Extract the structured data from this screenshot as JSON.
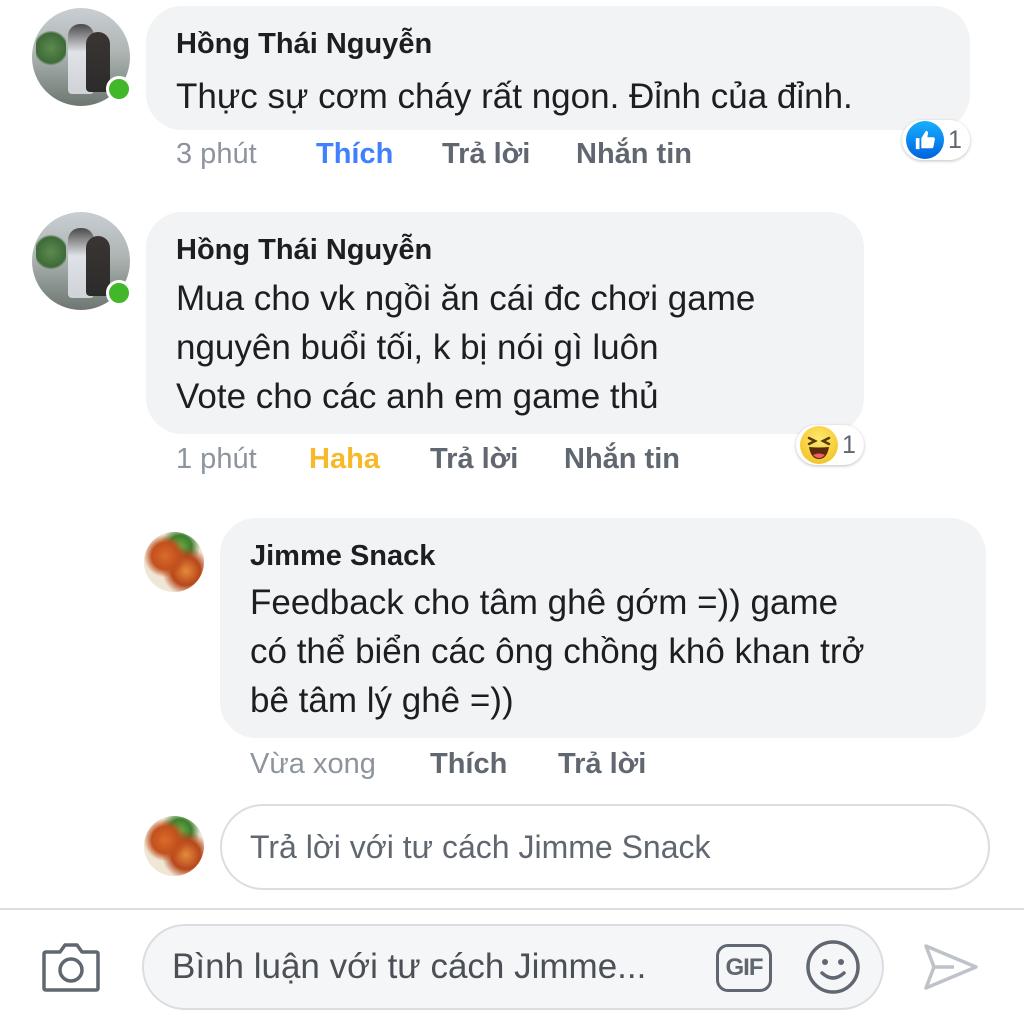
{
  "comments": [
    {
      "author": "Hồng Thái Nguyễn",
      "text": "Thực sự cơm cháy rất ngon. Đỉnh của đỉnh.",
      "time": "3 phút",
      "reaction_action": "Thích",
      "reply_label": "Trả lời",
      "message_label": "Nhắn tin",
      "reaction": {
        "icon": "like-icon",
        "count": "1"
      }
    },
    {
      "author": "Hồng Thái Nguyễn",
      "text": "Mua cho vk ngồi ăn cái đc chơi game\nnguyên buổi tối, k bị nói gì luôn\nVote cho các anh em game thủ",
      "time": "1 phút",
      "reaction_action": "Haha",
      "reply_label": "Trả lời",
      "message_label": "Nhắn tin",
      "reaction": {
        "icon": "haha-icon",
        "count": "1"
      }
    }
  ],
  "reply": {
    "author": "Jimme Snack",
    "text": "Feedback cho tâm ghê gớm =))  game\ncó thể biển các ông chồng khô khan trở\nbê tâm lý ghê =))",
    "time": "Vừa xong",
    "like_label": "Thích",
    "reply_label": "Trả lời"
  },
  "reply_input": {
    "placeholder": "Trả lời với tư cách Jimme Snack"
  },
  "composer": {
    "placeholder": "Bình luận với tư cách Jimme...",
    "gif_label": "GIF",
    "camera_icon": "camera-icon",
    "emoji_icon": "emoji-icon",
    "send_icon": "send-icon"
  },
  "colors": {
    "bubble": "#f2f3f5",
    "online": "#42b72a",
    "like_blue": "#4080ff",
    "haha_yellow": "#f7b928",
    "meta_gray": "#8d949e"
  }
}
